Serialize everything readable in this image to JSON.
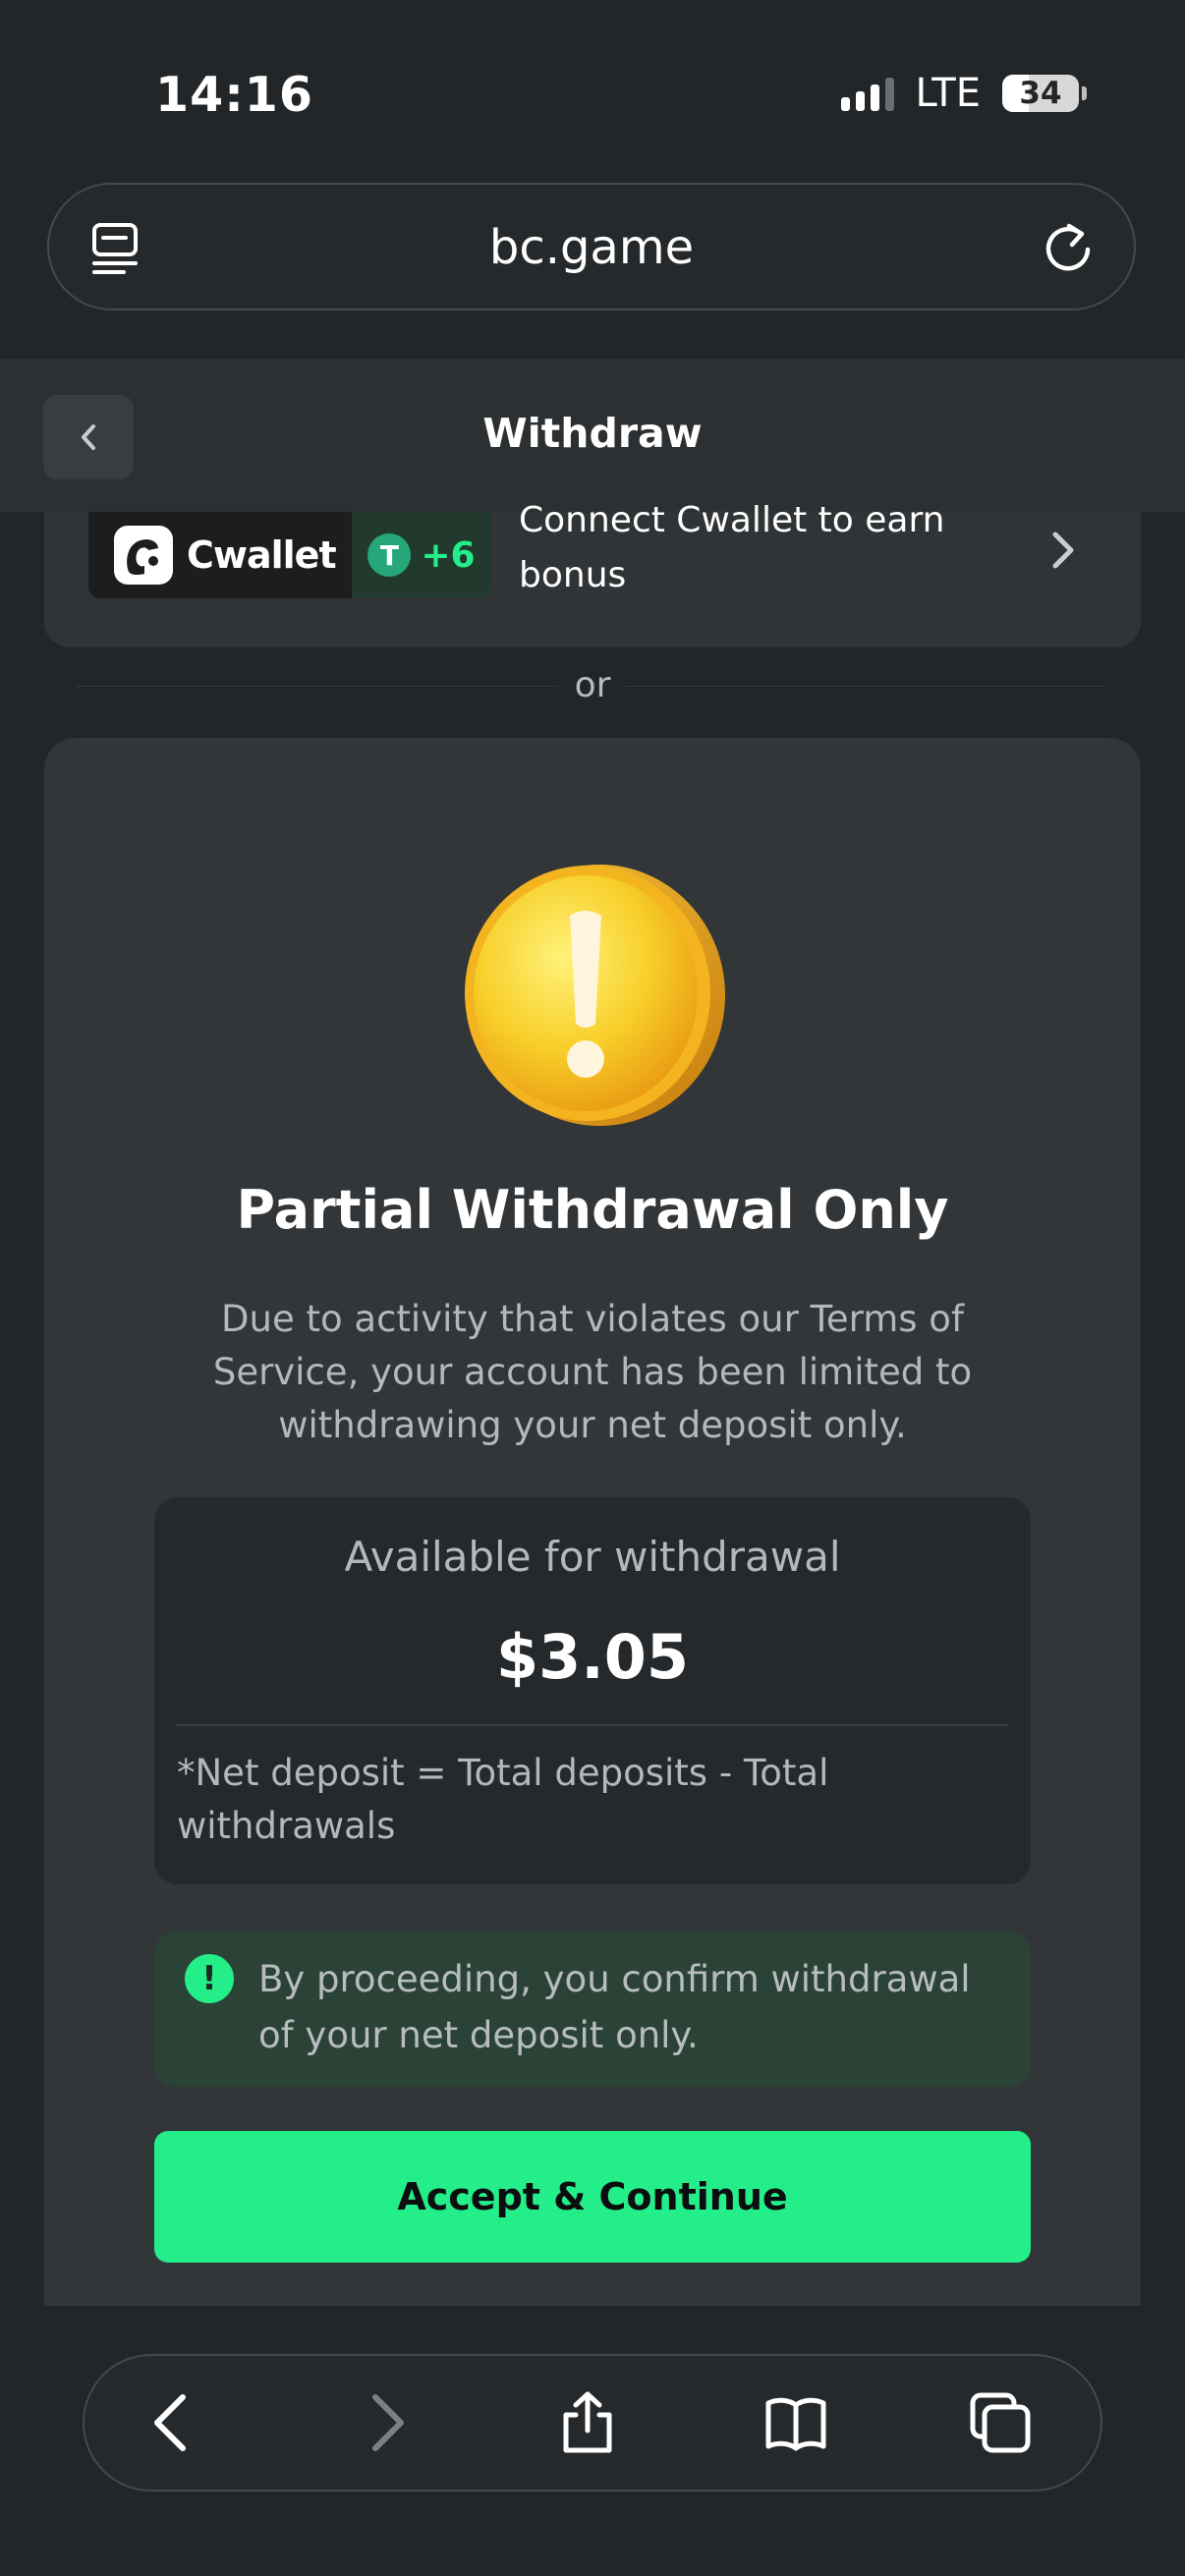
{
  "status_bar": {
    "time": "14:16",
    "network": "LTE",
    "battery": "34"
  },
  "browser": {
    "url": "bc.game"
  },
  "page": {
    "title": "Withdraw"
  },
  "cwallet": {
    "brand": "Cwallet",
    "bonus_badge": "+6",
    "promo_text": "Connect Cwallet to earn bonus"
  },
  "divider": {
    "or_label": "or"
  },
  "modal": {
    "title": "Partial Withdrawal Only",
    "description": "Due to activity that violates our Terms of Service, your account has been limited to withdrawing your net deposit only.",
    "available_label": "Available for withdrawal",
    "available_amount": "$3.05",
    "note": "*Net deposit = Total deposits - Total withdrawals",
    "confirm_text": "By proceeding, you confirm withdrawal of your net deposit only.",
    "accept_button": "Accept & Continue"
  },
  "toolbar": {
    "icons": [
      "back-icon",
      "forward-icon",
      "share-icon",
      "bookmarks-icon",
      "tabs-icon"
    ]
  },
  "colors": {
    "accent": "#24ee89",
    "background": "#232628",
    "card": "#323638"
  }
}
